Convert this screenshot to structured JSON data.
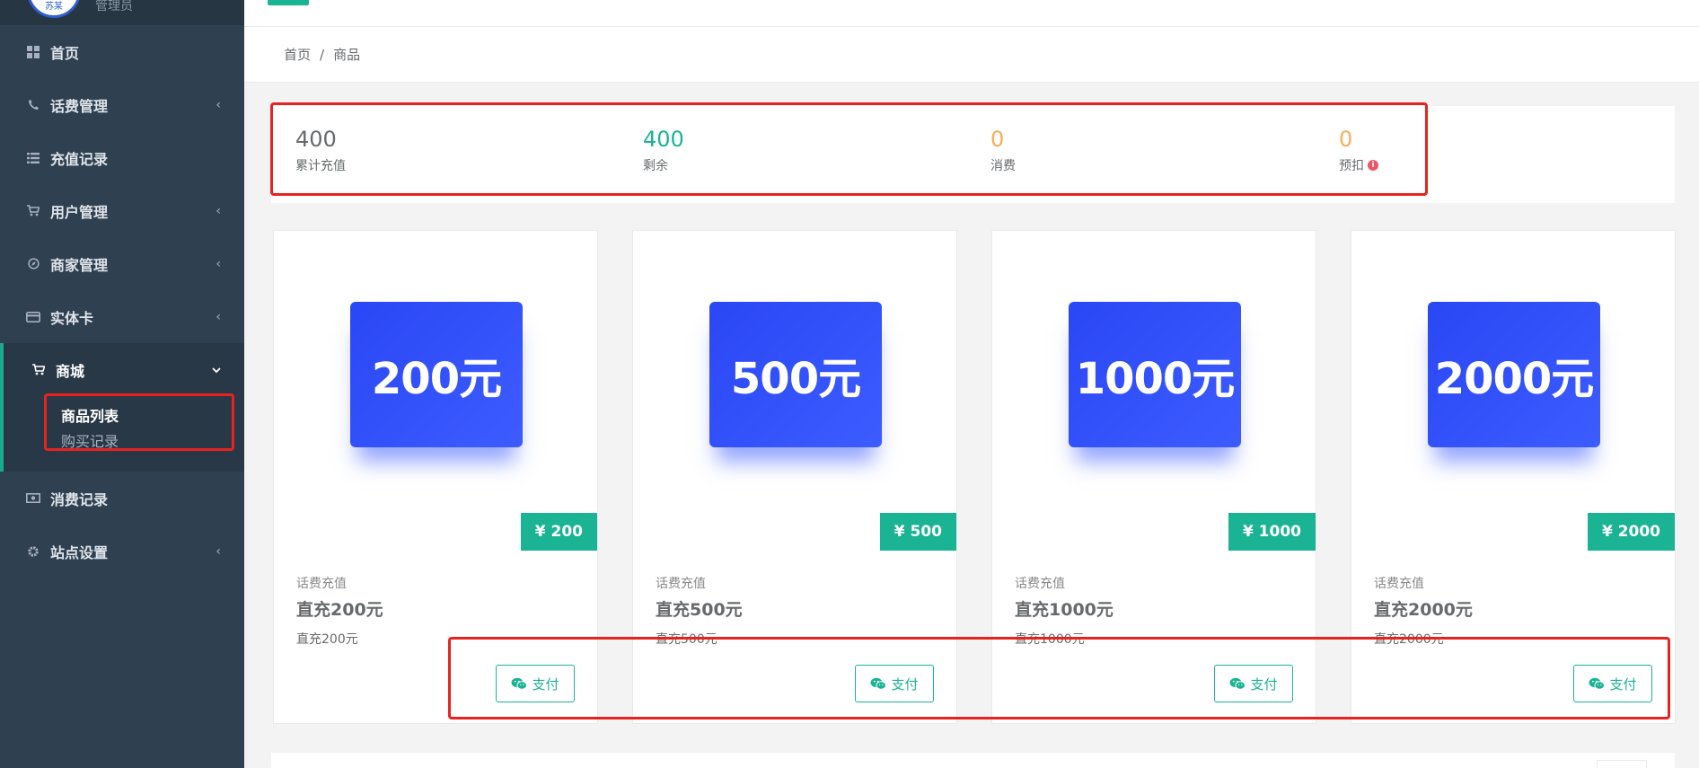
{
  "sidebar": {
    "profile": {
      "avatar_text": "苏某",
      "role": "管理员"
    },
    "items": [
      {
        "icon": "dashboard-icon",
        "label": "首页",
        "expandable": false
      },
      {
        "icon": "phone-icon",
        "label": "话费管理",
        "expandable": true
      },
      {
        "icon": "list-icon",
        "label": "充值记录",
        "expandable": false
      },
      {
        "icon": "cart-icon",
        "label": "用户管理",
        "expandable": true
      },
      {
        "icon": "compass-icon",
        "label": "商家管理",
        "expandable": true
      },
      {
        "icon": "card-icon",
        "label": "实体卡",
        "expandable": true
      }
    ],
    "shop": {
      "icon": "cart-icon",
      "label": "商城",
      "children": [
        {
          "label": "商品列表",
          "active": true
        },
        {
          "label": "购买记录",
          "active": false
        }
      ]
    },
    "items_after": [
      {
        "icon": "money-icon",
        "label": "消费记录",
        "expandable": false
      },
      {
        "icon": "gear-icon",
        "label": "站点设置",
        "expandable": true
      }
    ]
  },
  "breadcrumb": {
    "home": "首页",
    "separator": "/",
    "current": "商品"
  },
  "stats": [
    {
      "value": "400",
      "label": "累计充值",
      "color": "#676a6c"
    },
    {
      "value": "400",
      "label": "剩余",
      "color": "#1ab394"
    },
    {
      "value": "0",
      "label": "消费",
      "color": "#f8ac59"
    },
    {
      "value": "0",
      "label": "预扣",
      "color": "#f8ac59",
      "info_icon": true
    }
  ],
  "products": [
    {
      "image_text": "200元",
      "price": "¥ 200",
      "category": "话费充值",
      "name": "直充200元",
      "desc": "直充200元",
      "pay_label": "支付"
    },
    {
      "image_text": "500元",
      "price": "¥ 500",
      "category": "话费充值",
      "name": "直充500元",
      "desc": "直充500元",
      "pay_label": "支付"
    },
    {
      "image_text": "1000元",
      "price": "¥ 1000",
      "category": "话费充值",
      "name": "直充1000元",
      "desc": "直充1000元",
      "pay_label": "支付"
    },
    {
      "image_text": "2000元",
      "price": "¥ 2000",
      "category": "话费充值",
      "name": "直充2000元",
      "desc": "直充2000元",
      "pay_label": "支付"
    }
  ],
  "colors": {
    "sidebar_bg": "#2f4050",
    "accent": "#1ab394",
    "warning": "#f8ac59",
    "danger": "#ed5565",
    "product_blue": "#2a47f5",
    "annotation_red": "#e8231f"
  }
}
